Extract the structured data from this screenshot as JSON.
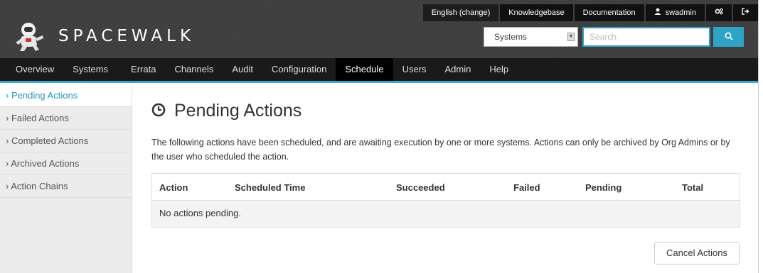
{
  "header": {
    "top_links": [
      {
        "label": "English (change)"
      },
      {
        "label": "Knowledgebase"
      },
      {
        "label": "Documentation"
      },
      {
        "label": "swadmin",
        "icon": "user-icon"
      }
    ],
    "logo_text": "SPACEWALK",
    "search": {
      "scope": "Systems",
      "placeholder": "Search"
    }
  },
  "nav": {
    "items": [
      "Overview",
      "Systems",
      "Errata",
      "Channels",
      "Audit",
      "Configuration",
      "Schedule",
      "Users",
      "Admin",
      "Help"
    ],
    "active": "Schedule"
  },
  "sidebar": {
    "items": [
      {
        "label": "Pending Actions"
      },
      {
        "label": "Failed Actions"
      },
      {
        "label": "Completed Actions"
      },
      {
        "label": "Archived Actions"
      },
      {
        "label": "Action Chains"
      }
    ]
  },
  "main": {
    "title": "Pending Actions",
    "description": "The following actions have been scheduled, and are awaiting execution by one or more systems. Actions can only be archived by Org Admins or by the user who scheduled the action.",
    "table": {
      "columns": [
        "Action",
        "Scheduled Time",
        "Succeeded",
        "Failed",
        "Pending",
        "Total"
      ],
      "empty_message": "No actions pending."
    },
    "cancel_label": "Cancel Actions"
  },
  "colors": {
    "accent": "#2fa3c5",
    "nav_bg": "#1a1a1a"
  }
}
